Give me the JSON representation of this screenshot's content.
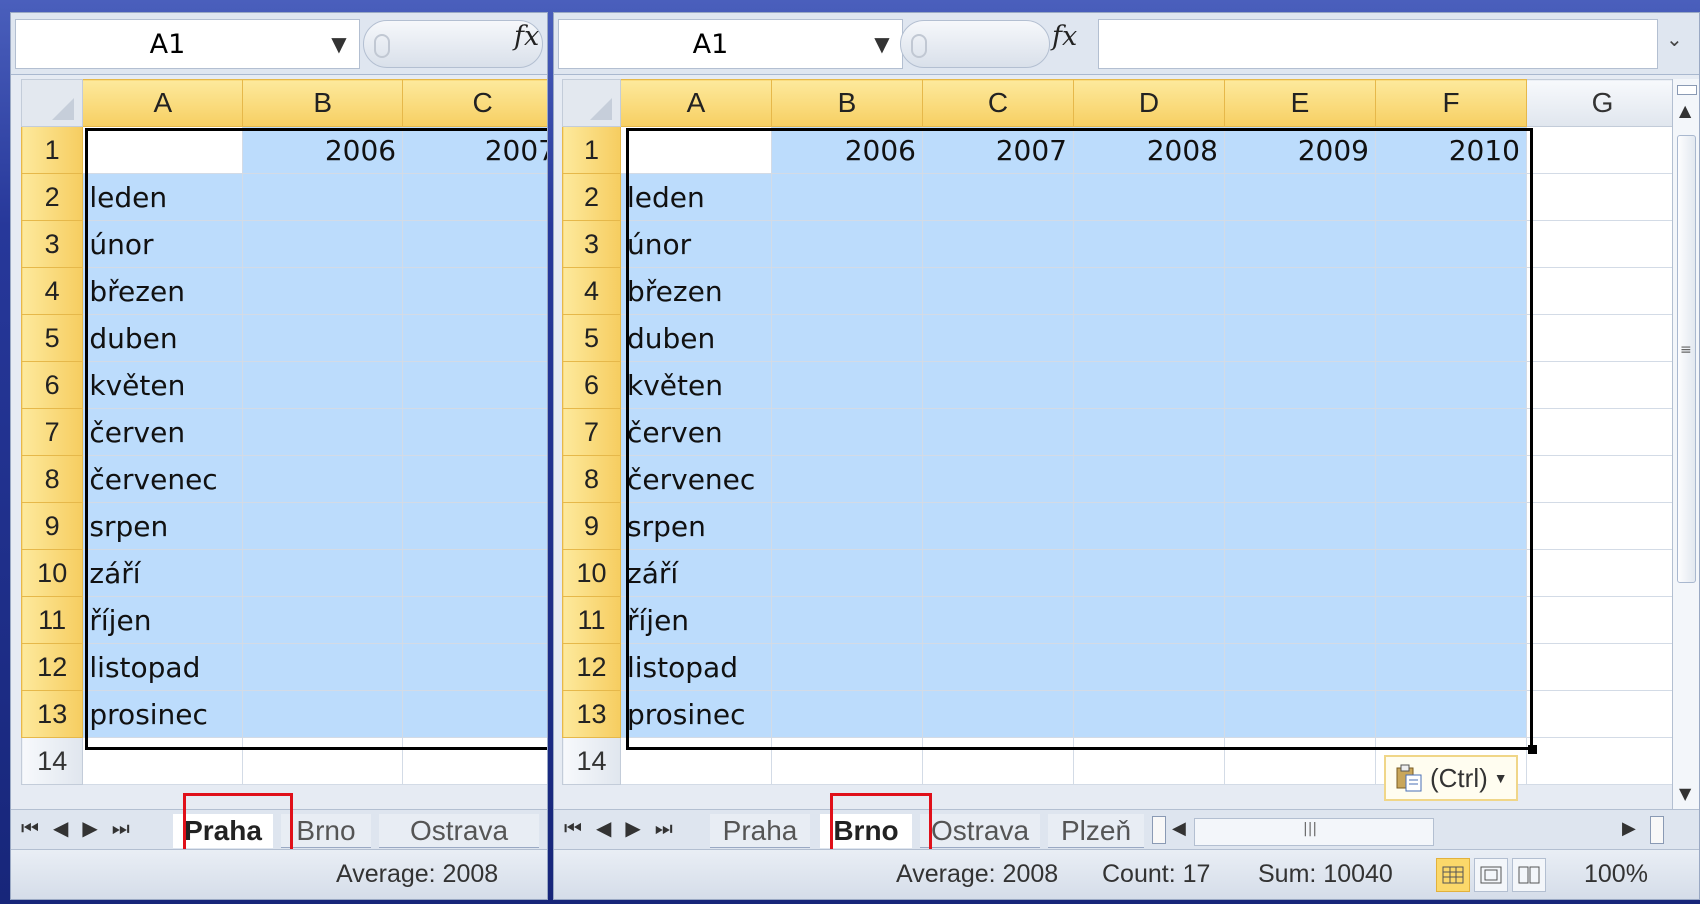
{
  "left": {
    "name_box": "A1",
    "fx_label": "fx",
    "columns": [
      "A",
      "B",
      "C"
    ],
    "year_headers": [
      "2006",
      "2007"
    ],
    "tabs": [
      "Praha",
      "Brno",
      "Ostrava"
    ],
    "active_tab": "Praha",
    "status": {
      "average": "Average: 2008"
    }
  },
  "right": {
    "name_box": "A1",
    "fx_label": "fx",
    "columns": [
      "A",
      "B",
      "C",
      "D",
      "E",
      "F",
      "G"
    ],
    "year_headers": [
      "2006",
      "2007",
      "2008",
      "2009",
      "2010"
    ],
    "tabs": [
      "Praha",
      "Brno",
      "Ostrava",
      "Plzeň"
    ],
    "active_tab": "Brno",
    "status": {
      "average": "Average: 2008",
      "count": "Count: 17",
      "sum": "Sum: 10040",
      "zoom": "100%"
    },
    "paste_label": "(Ctrl)"
  },
  "rows": [
    "1",
    "2",
    "3",
    "4",
    "5",
    "6",
    "7",
    "8",
    "9",
    "10",
    "11",
    "12",
    "13",
    "14"
  ],
  "months": [
    "leden",
    "únor",
    "březen",
    "duben",
    "květen",
    "červen",
    "červenec",
    "srpen",
    "září",
    "říjen",
    "listopad",
    "prosinec"
  ],
  "colors": {
    "selection": "#bcdcfc",
    "header_highlight": "#f7cf62",
    "red_outline": "#e0101a"
  },
  "icons": [
    "dropdown-arrow-icon",
    "fx-icon",
    "first-sheet-icon",
    "prev-sheet-icon",
    "next-sheet-icon",
    "last-sheet-icon",
    "paste-icon",
    "normal-view-icon",
    "page-layout-icon",
    "page-break-icon"
  ]
}
